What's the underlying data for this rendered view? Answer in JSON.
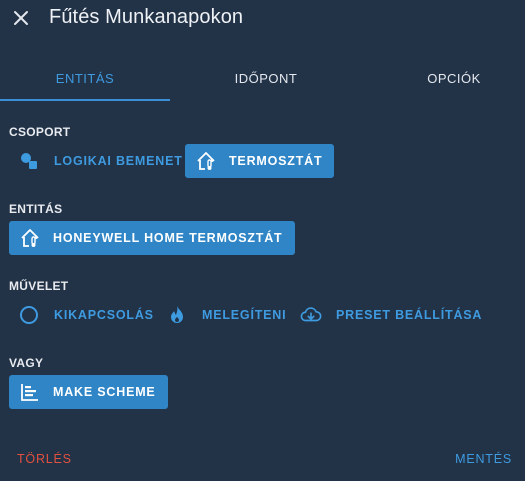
{
  "header": {
    "title": "Fűtés Munkanapokon",
    "close_icon": "close-icon"
  },
  "tabs": [
    {
      "label": "ENTITÁS",
      "active": true
    },
    {
      "label": "IDŐPONT",
      "active": false
    },
    {
      "label": "OPCIÓK",
      "active": false
    }
  ],
  "group": {
    "label": "CSOPORT",
    "options": [
      {
        "label": "LOGIKAI BEMENET",
        "icon": "toggle-input-icon",
        "selected": false
      },
      {
        "label": "TERMOSZTÁT",
        "icon": "home-thermometer-icon",
        "selected": true
      }
    ]
  },
  "entity": {
    "label": "ENTITÁS",
    "value": "HONEYWELL HOME TERMOSZTÁT",
    "icon": "home-thermometer-icon"
  },
  "action": {
    "label": "MŰVELET",
    "options": [
      {
        "label": "KIKAPCSOLÁS",
        "icon": "power-off-icon"
      },
      {
        "label": "MELEGÍTENI",
        "icon": "fire-icon"
      },
      {
        "label": "PRESET BEÁLLÍTÁSA",
        "icon": "cloud-download-icon"
      }
    ]
  },
  "or": {
    "label": "VAGY",
    "button": "MAKE SCHEME",
    "icon": "scheme-timeline-icon"
  },
  "footer": {
    "delete_label": "TÖRLÉS",
    "save_label": "MENTÉS"
  },
  "colors": {
    "background": "#223247",
    "accent": "#3e9be0",
    "button_fill": "#2f85c6",
    "danger": "#e0513f"
  }
}
